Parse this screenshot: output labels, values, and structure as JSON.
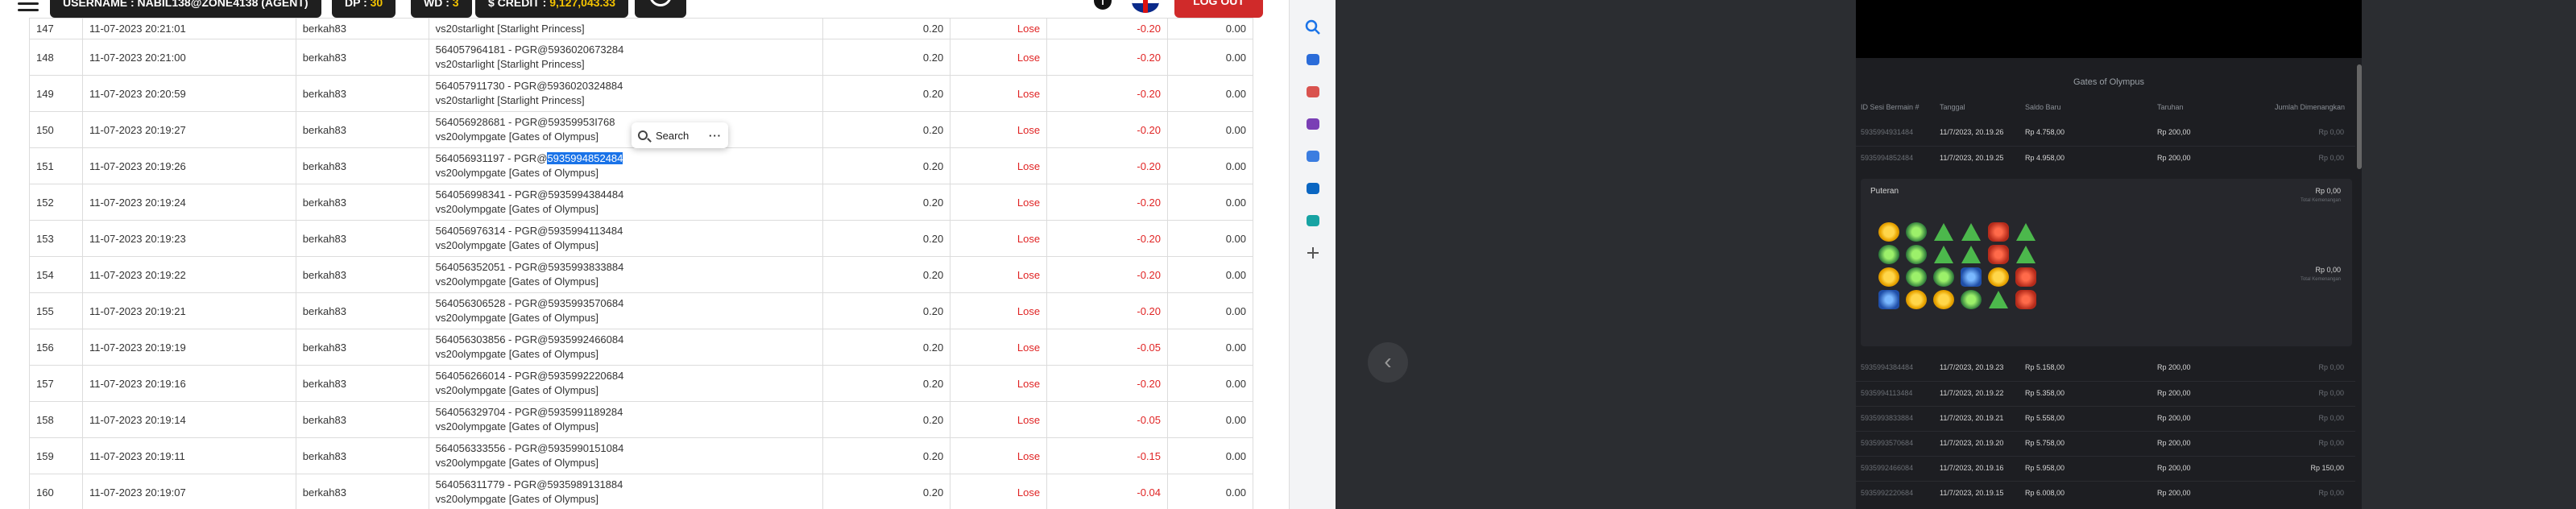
{
  "topbar": {
    "username": "USERNAME : NABIL138@ZONE4138 (AGENT)",
    "dp_label": "DP :",
    "dp_value": "30",
    "wd_label": "WD :",
    "wd_value": "3",
    "credit_label": "$ CREDIT :",
    "credit_value": "9,127,043.33",
    "logout": "LOG OUT"
  },
  "table": {
    "rows": [
      {
        "no": "147",
        "date": "11-07-2023 20:21:01",
        "user": "berkah83",
        "ref1": "",
        "ref2": "vs20starlight [Starlight Princess]",
        "amount": "0.20",
        "status": "Lose",
        "win": "-0.20",
        "balance": "0.00"
      },
      {
        "no": "148",
        "date": "11-07-2023 20:21:00",
        "user": "berkah83",
        "ref1": "564057964181 - PGR@5936020673284",
        "ref2": "vs20starlight [Starlight Princess]",
        "amount": "0.20",
        "status": "Lose",
        "win": "-0.20",
        "balance": "0.00"
      },
      {
        "no": "149",
        "date": "11-07-2023 20:20:59",
        "user": "berkah83",
        "ref1": "564057911730 - PGR@5936020324884",
        "ref2": "vs20starlight [Starlight Princess]",
        "amount": "0.20",
        "status": "Lose",
        "win": "-0.20",
        "balance": "0.00"
      },
      {
        "no": "150",
        "date": "11-07-2023 20:19:27",
        "user": "berkah83",
        "ref1": "564056928681 - PGR@59359953I768",
        "ref2": "vs20olympgate [Gates of Olympus]",
        "amount": "0.20",
        "status": "Lose",
        "win": "-0.20",
        "balance": "0.00"
      },
      {
        "no": "151",
        "date": "11-07-2023 20:19:26",
        "user": "berkah83",
        "ref1a": "564056931197 - PGR@",
        "ref1b": "5935994852484",
        "ref2": "vs20olympgate [Gates of Olympus]",
        "amount": "0.20",
        "status": "Lose",
        "win": "-0.20",
        "balance": "0.00"
      },
      {
        "no": "152",
        "date": "11-07-2023 20:19:24",
        "user": "berkah83",
        "ref1": "564056998341 - PGR@5935994384484",
        "ref2": "vs20olympgate [Gates of Olympus]",
        "amount": "0.20",
        "status": "Lose",
        "win": "-0.20",
        "balance": "0.00"
      },
      {
        "no": "153",
        "date": "11-07-2023 20:19:23",
        "user": "berkah83",
        "ref1": "564056976314 - PGR@5935994113484",
        "ref2": "vs20olympgate [Gates of Olympus]",
        "amount": "0.20",
        "status": "Lose",
        "win": "-0.20",
        "balance": "0.00"
      },
      {
        "no": "154",
        "date": "11-07-2023 20:19:22",
        "user": "berkah83",
        "ref1": "564056352051 - PGR@5935993833884",
        "ref2": "vs20olympgate [Gates of Olympus]",
        "amount": "0.20",
        "status": "Lose",
        "win": "-0.20",
        "balance": "0.00"
      },
      {
        "no": "155",
        "date": "11-07-2023 20:19:21",
        "user": "berkah83",
        "ref1": "564056306528 - PGR@5935993570684",
        "ref2": "vs20olympgate [Gates of Olympus]",
        "amount": "0.20",
        "status": "Lose",
        "win": "-0.20",
        "balance": "0.00"
      },
      {
        "no": "156",
        "date": "11-07-2023 20:19:19",
        "user": "berkah83",
        "ref1": "564056303856 - PGR@5935992466084",
        "ref2": "vs20olympgate [Gates of Olympus]",
        "amount": "0.20",
        "status": "Lose",
        "win": "-0.05",
        "balance": "0.00"
      },
      {
        "no": "157",
        "date": "11-07-2023 20:19:16",
        "user": "berkah83",
        "ref1": "564056266014 - PGR@5935992220684",
        "ref2": "vs20olympgate [Gates of Olympus]",
        "amount": "0.20",
        "status": "Lose",
        "win": "-0.20",
        "balance": "0.00"
      },
      {
        "no": "158",
        "date": "11-07-2023 20:19:14",
        "user": "berkah83",
        "ref1": "564056329704 - PGR@5935991189284",
        "ref2": "vs20olympgate [Gates of Olympus]",
        "amount": "0.20",
        "status": "Lose",
        "win": "-0.05",
        "balance": "0.00"
      },
      {
        "no": "159",
        "date": "11-07-2023 20:19:11",
        "user": "berkah83",
        "ref1": "564056333556 - PGR@5935990151084",
        "ref2": "vs20olympgate [Gates of Olympus]",
        "amount": "0.20",
        "status": "Lose",
        "win": "-0.15",
        "balance": "0.00"
      },
      {
        "no": "160",
        "date": "11-07-2023 20:19:07",
        "user": "berkah83",
        "ref1": "564056311779 - PGR@5935989131884",
        "ref2": "vs20olympgate [Gates of Olympus]",
        "amount": "0.20",
        "status": "Lose",
        "win": "-0.04",
        "balance": "0.00"
      }
    ]
  },
  "search_popup": {
    "label": "Search",
    "more": "···"
  },
  "sidebar": {
    "icons": [
      "search-icon",
      "tag-icon",
      "briefcase-icon",
      "people-icon",
      "copilot-icon",
      "outlook-icon",
      "shopping-icon",
      "add-icon"
    ],
    "colors": [
      "#1a73e8",
      "#2b6cd9",
      "#d9534f",
      "#7a3fb5",
      "#3b7de0",
      "#0a66c2",
      "#17a3a3",
      "#555555"
    ]
  },
  "game": {
    "title": "Gates of Olympus",
    "headers": [
      "ID Sesi Bermain #",
      "Tanggal",
      "Saldo Baru",
      "Taruhan",
      "Jumlah Dimenangkan"
    ],
    "rows_top": [
      {
        "id": "5935994931484",
        "date": "11/7/2023, 20.19.26",
        "saldo": "Rp 4.758,00",
        "taruhan": "Rp 200,00",
        "win": "Rp 0,00"
      },
      {
        "id": "5935994852484",
        "date": "11/7/2023, 20.19.25",
        "saldo": "Rp 4.958,00",
        "taruhan": "Rp 200,00",
        "win": "Rp 0,00"
      }
    ],
    "puteran": {
      "label": "Puteran",
      "amount1": "Rp 0,00",
      "sub1": "Total Kemenangan",
      "amount2": "Rp 0,00",
      "sub2": "Total Kemenangan"
    },
    "rows_bottom": [
      {
        "id": "5935994384484",
        "date": "11/7/2023, 20.19.23",
        "saldo": "Rp 5.158,00",
        "taruhan": "Rp 200,00",
        "win": "Rp 0,00"
      },
      {
        "id": "5935994113484",
        "date": "11/7/2023, 20.19.22",
        "saldo": "Rp 5.358,00",
        "taruhan": "Rp 200,00",
        "win": "Rp 0,00"
      },
      {
        "id": "5935993833884",
        "date": "11/7/2023, 20.19.21",
        "saldo": "Rp 5.558,00",
        "taruhan": "Rp 200,00",
        "win": "Rp 0,00"
      },
      {
        "id": "5935993570684",
        "date": "11/7/2023, 20.19.20",
        "saldo": "Rp 5.758,00",
        "taruhan": "Rp 200,00",
        "win": "Rp 0,00"
      },
      {
        "id": "5935992466084",
        "date": "11/7/2023, 20.19.16",
        "saldo": "Rp 5.958,00",
        "taruhan": "Rp 200,00",
        "win": "Rp 150,00",
        "is_win": true
      },
      {
        "id": "5935992220684",
        "date": "11/7/2023, 20.19.15",
        "saldo": "Rp 6.008,00",
        "taruhan": "Rp 200,00",
        "win": "Rp 0,00"
      }
    ],
    "symbols": [
      "ring",
      "gob",
      "tri",
      "tri",
      "red",
      "tri",
      "gob",
      "gob",
      "tri",
      "tri",
      "red",
      "tri",
      "ring",
      "gob",
      "gob",
      "hat",
      "ring",
      "red",
      "hat",
      "ring",
      "ring",
      "gob",
      "tri",
      "red"
    ]
  },
  "background": {
    "back_arrow": "‹"
  }
}
